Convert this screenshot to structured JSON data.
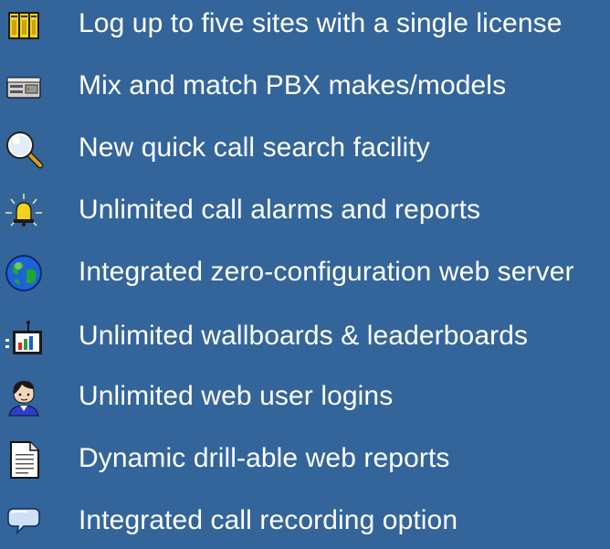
{
  "features": [
    {
      "label": "Log up to five sites with a single license",
      "icon": "server-racks-icon"
    },
    {
      "label": "Mix and match PBX makes/models",
      "icon": "pbx-device-icon"
    },
    {
      "label": "New quick call search facility",
      "icon": "magnifying-glass-icon"
    },
    {
      "label": "Unlimited call alarms and reports",
      "icon": "alarm-bell-icon"
    },
    {
      "label": "Integrated zero-configuration web server",
      "icon": "globe-icon"
    },
    {
      "label": "Unlimited wallboards & leaderboards",
      "icon": "wallboard-tv-icon"
    },
    {
      "label": "Unlimited web user logins",
      "icon": "user-avatar-icon"
    },
    {
      "label": "Dynamic drill-able web reports",
      "icon": "document-icon"
    },
    {
      "label": "Integrated call recording option",
      "icon": "speech-bubble-icon"
    }
  ]
}
